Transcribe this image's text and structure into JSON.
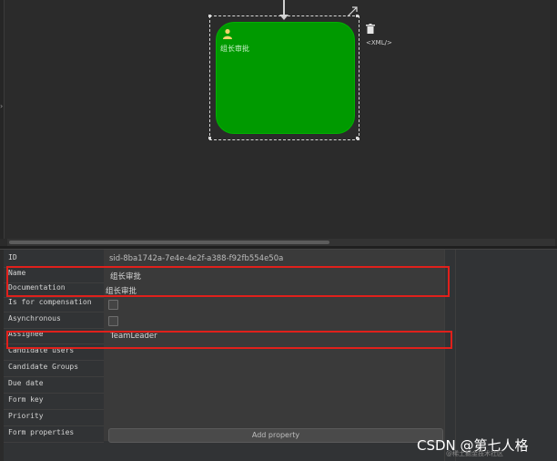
{
  "canvas": {
    "task": {
      "label": "组长审批",
      "fill_color": "#009a00"
    },
    "xml_label": "<XML/>",
    "icons": {
      "user": "user-icon",
      "resize": "resize-arrow-icon",
      "trash": "trash-icon"
    }
  },
  "properties": {
    "rows": [
      {
        "label": "ID"
      },
      {
        "label": "Name"
      },
      {
        "label": "Documentation"
      },
      {
        "label": "Is for compensation"
      },
      {
        "label": "Asynchronous"
      },
      {
        "label": "Assignee"
      },
      {
        "label": "Candidate users"
      },
      {
        "label": "Candidate Groups"
      },
      {
        "label": "Due date"
      },
      {
        "label": "Form key"
      },
      {
        "label": "Priority"
      },
      {
        "label": "Form properties"
      }
    ],
    "id_value": "sid-8ba1742a-7e4e-4e2f-a388-f92fb554e50a",
    "name_value": "组长审批",
    "documentation_value": "组长审批",
    "is_for_compensation": false,
    "asynchronous": false,
    "assignee_value": "TeamLeader",
    "add_property_label": "Add property"
  },
  "annotation_color": "#e0201b",
  "watermark": {
    "main": "CSDN @第七人格",
    "sub": "@稀土掘金技术社区"
  }
}
